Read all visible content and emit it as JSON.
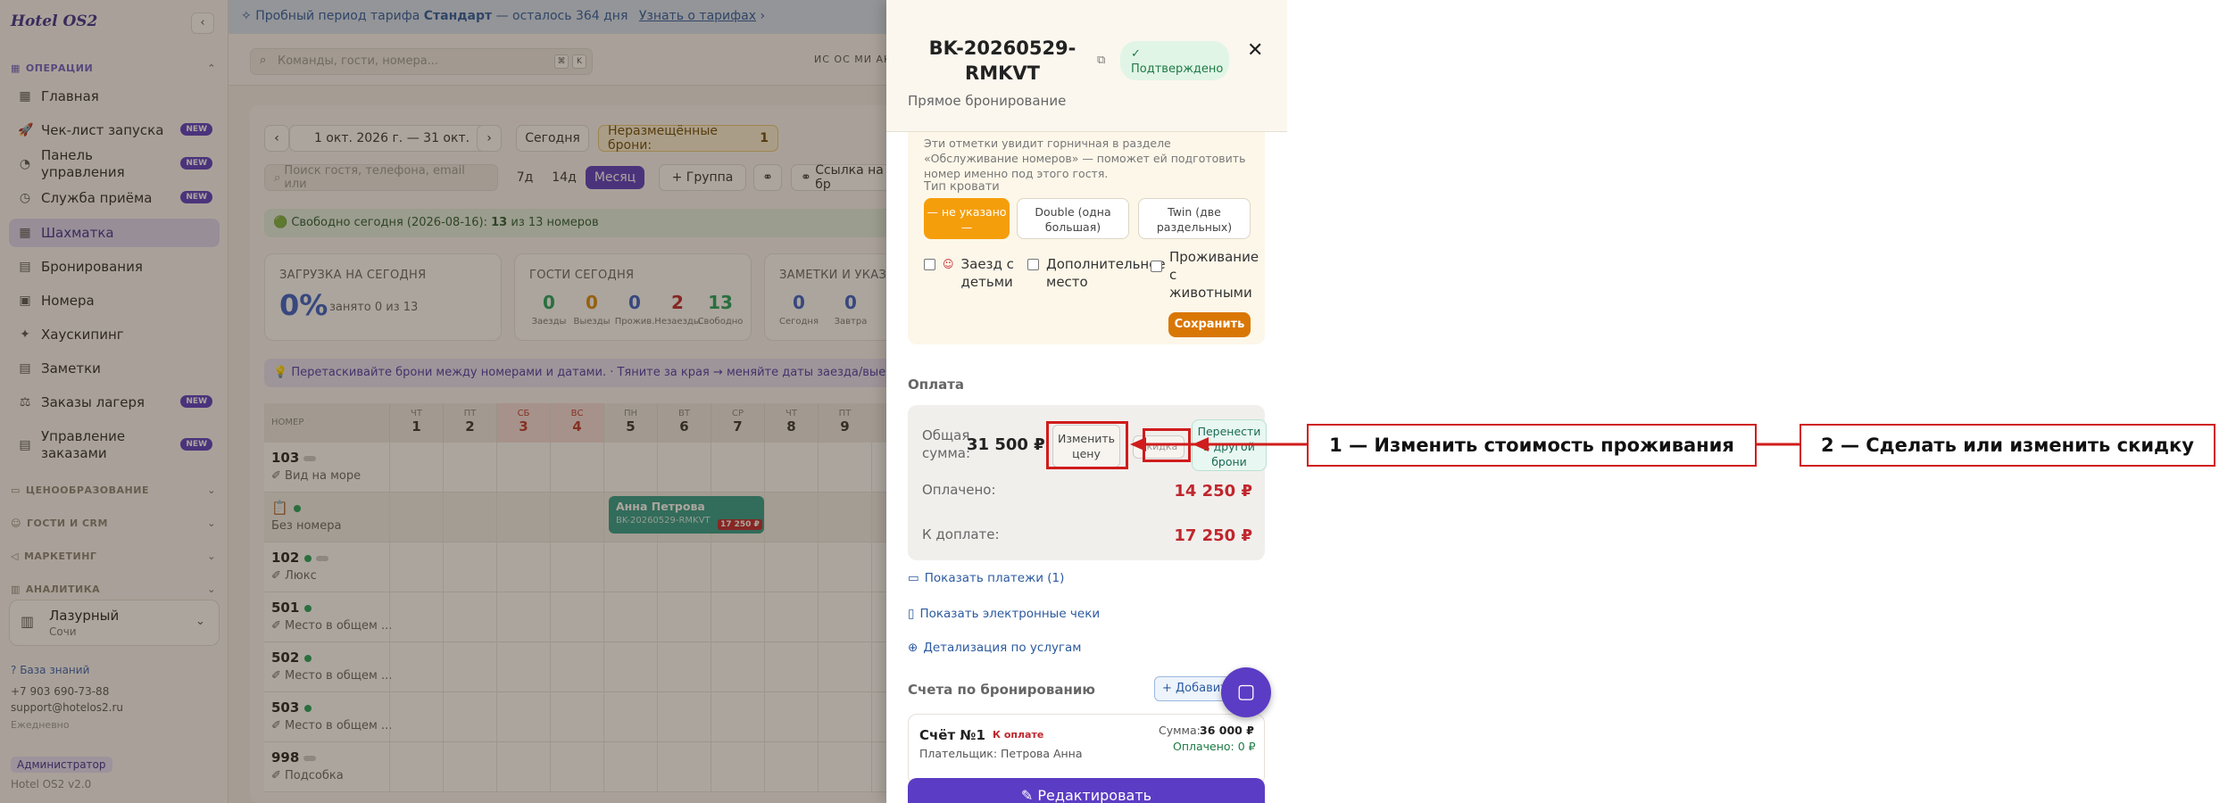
{
  "app": {
    "logo": "Hotel OS2"
  },
  "trial": {
    "prefix": "Пробный период тарифа",
    "plan": "Стандарт",
    "remaining": "— осталось 364 дня",
    "link": "Узнать о тарифах",
    "arrow": "›"
  },
  "command": {
    "placeholder": "Команды, гости, номера...",
    "k1": "⌘",
    "k2": "K"
  },
  "avatars": "ИС ОС МИ АК",
  "sidebar": {
    "section_ops": "ОПЕРАЦИИ",
    "items": [
      {
        "label": "Главная",
        "icon": "▦",
        "new": ""
      },
      {
        "label": "Чек-лист запуска",
        "icon": "🚀",
        "new": "NEW"
      },
      {
        "label": "Панель управления",
        "icon": "◔",
        "new": "NEW"
      },
      {
        "label": "Служба приёма",
        "icon": "◷",
        "new": "NEW"
      },
      {
        "label": "Шахматка",
        "icon": "▦",
        "new": ""
      },
      {
        "label": "Бронирования",
        "icon": "▤",
        "new": ""
      },
      {
        "label": "Номера",
        "icon": "▣",
        "new": ""
      },
      {
        "label": "Хаускипинг",
        "icon": "✦",
        "new": ""
      },
      {
        "label": "Заметки",
        "icon": "▤",
        "new": ""
      },
      {
        "label": "Заказы лагеря",
        "icon": "⚖",
        "new": "NEW"
      },
      {
        "label": "Управление заказами",
        "icon": "▤",
        "new": "NEW"
      }
    ],
    "section_pricing": "ЦЕНООБРАЗОВАНИЕ",
    "section_guests": "ГОСТИ И CRM",
    "section_marketing": "МАРКЕТИНГ",
    "section_analytics": "АНАЛИТИКА",
    "hotel": {
      "name": "Лазурный",
      "city": "Сочи"
    },
    "kb": "База знаний",
    "phone": "+7 903 690-73-88",
    "email": "support@hotelos2.ru",
    "daily": "Ежедневно",
    "role": "Администратор",
    "version": "Hotel OS2 v2.0"
  },
  "toolbar": {
    "range": "1 окт. 2026 г. — 31 окт.",
    "today": "Сегодня",
    "unplaced": "Неразмещённые брони:",
    "unplaced_count": "1",
    "search": "Поиск гостя, телефона, email или",
    "v7": "7д",
    "v14": "14д",
    "vm": "Месяц",
    "group": "+ Группа",
    "link_label": "Ссылка на бр"
  },
  "free_banner": {
    "text": "🟢 Свободно сегодня (2026-08-16):",
    "count": "13",
    "rest": "из 13 номеров"
  },
  "stats": {
    "load_title": "ЗАГРУЗКА НА СЕГОДНЯ",
    "load_value": "0%",
    "load_sub": "занято 0 из 13",
    "guests_title": "ГОСТИ СЕГОДНЯ",
    "guests": [
      {
        "v": "0",
        "l": "Заезды",
        "c": "#22a35a"
      },
      {
        "v": "0",
        "l": "Выезды",
        "c": "#d98a0b"
      },
      {
        "v": "0",
        "l": "Прожив.",
        "c": "#3a5fc9"
      },
      {
        "v": "2",
        "l": "Незаезды",
        "c": "#c0262d"
      },
      {
        "v": "13",
        "l": "Свободно",
        "c": "#22a35a"
      }
    ],
    "notes_title": "ЗАМЕТКИ И УКАЗА",
    "notes": [
      {
        "v": "0",
        "l": "Сегодня"
      },
      {
        "v": "0",
        "l": "Завтра"
      }
    ]
  },
  "hint": "💡 Перетаскивайте брони между номерами и датами. · Тяните за края → меняйте даты заезда/выезда.",
  "grid": {
    "room_header": "НОМЕР",
    "days": [
      {
        "w": "ЧТ",
        "d": "1",
        "we": false
      },
      {
        "w": "ПТ",
        "d": "2",
        "we": false
      },
      {
        "w": "СБ",
        "d": "3",
        "we": true
      },
      {
        "w": "ВС",
        "d": "4",
        "we": true
      },
      {
        "w": "ПН",
        "d": "5",
        "we": false
      },
      {
        "w": "ВТ",
        "d": "6",
        "we": false
      },
      {
        "w": "СР",
        "d": "7",
        "we": false
      },
      {
        "w": "ЧТ",
        "d": "8",
        "we": false
      },
      {
        "w": "ПТ",
        "d": "9",
        "we": false
      }
    ],
    "rows": [
      {
        "n": "103",
        "t": "✐ Вид на море"
      },
      {
        "n": "📋",
        "t": "Без номера"
      },
      {
        "n": "102",
        "t": "✐ Люкс"
      },
      {
        "n": "501",
        "t": "✐ Место в общем ..."
      },
      {
        "n": "502",
        "t": "✐ Место в общем ..."
      },
      {
        "n": "503",
        "t": "✐ Место в общем ..."
      },
      {
        "n": "998",
        "t": "✐ Подсобка"
      }
    ],
    "booking": {
      "guest": "Анна Петрова",
      "code": "BK-20260529-RMKVT",
      "price": "17 250 ₽"
    }
  },
  "drawer": {
    "code": "BK-20260529-RMKVT",
    "status": "Подтверждено",
    "subtitle": "Прямое бронирование",
    "pref_note": "Эти отметки увидит горничная в разделе «Обслуживание номеров» — поможет ей подготовить номер именно под этого гостя.",
    "bed_label": "Тип кровати",
    "beds": [
      "— не указано —",
      "Double (одна большая)",
      "Twin (две раздельных)"
    ],
    "chk_kids": "Заезд с детьми",
    "chk_extra": "Дополнительное место",
    "chk_pets": "Проживание с животными",
    "save": "Сохранить",
    "pay_title": "Оплата",
    "total_label": "Общая сумма:",
    "total_value": "31 500 ₽",
    "change_price": "Изменить цену",
    "discount": "Скидка",
    "move": "Перенести в другой брони",
    "paid_label": "Оплачено:",
    "paid_value": "14 250 ₽",
    "due_label": "К доплате:",
    "due_value": "17 250 ₽",
    "show_payments": "Показать платежи (1)",
    "show_receipts": "Показать электронные чеки",
    "details": "Детализация по услугам",
    "invoices_title": "Счета по бронированию",
    "add": "+ Добавить",
    "invoice": {
      "name": "Счёт №1",
      "status": "К оплате",
      "payer": "Плательщик: Петрова Анна",
      "sum_label": "Сумма:",
      "sum": "36 000 ₽",
      "paid": "Оплачено: 0 ₽"
    },
    "edit": "✎ Редактировать"
  },
  "annotations": {
    "a1": "1 — Изменить стоимость проживания",
    "a2": "2 — Сделать или изменить скидку"
  },
  "colors": {
    "accent": "#5b3cc4",
    "annotation": "#d01c1c",
    "warning": "#f59e0b"
  }
}
